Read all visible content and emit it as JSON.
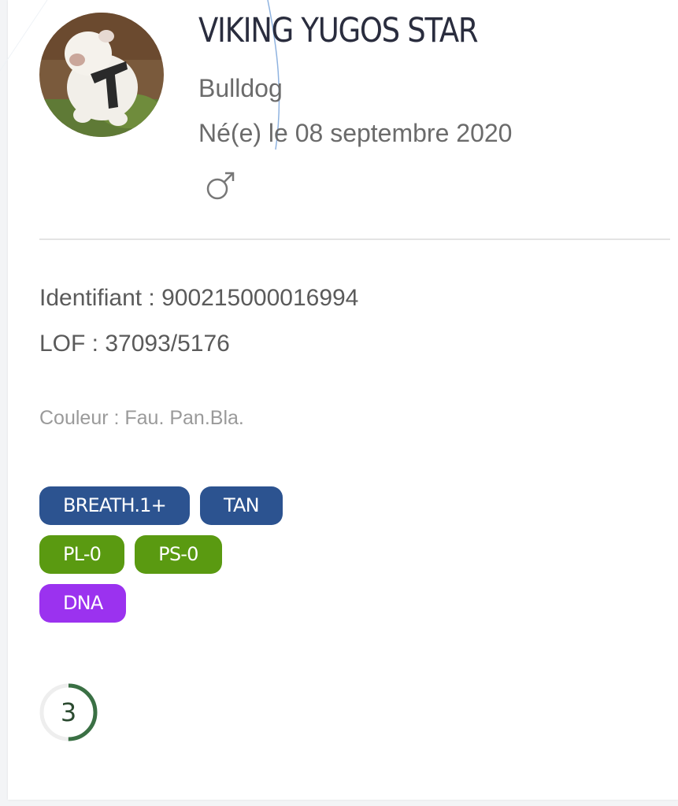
{
  "dog": {
    "name": "VIKING YUGOS STAR",
    "breed": "Bulldog",
    "born": "Né(e) le 08 septembre 2020",
    "sex_icon": "male-icon",
    "photo_icon": "dog-photo"
  },
  "identification": {
    "ident": "Identifiant : 900215000016994",
    "lof": "LOF : 37093/5176"
  },
  "color_text": "Couleur : Fau. Pan.Bla.",
  "tags": {
    "row1": [
      {
        "label": "BREATH.1+",
        "color": "#2c5390"
      },
      {
        "label": "TAN",
        "color": "#2c5390"
      }
    ],
    "row2": [
      {
        "label": "PL-0",
        "color": "#5a9a11"
      },
      {
        "label": "PS-0",
        "color": "#5a9a11"
      }
    ],
    "row3": [
      {
        "label": "DNA",
        "color": "#9b32ef"
      }
    ]
  },
  "score": {
    "value": "3",
    "fraction": 0.5,
    "ring_color": "#3a7044",
    "track_color": "#eeeeee"
  }
}
